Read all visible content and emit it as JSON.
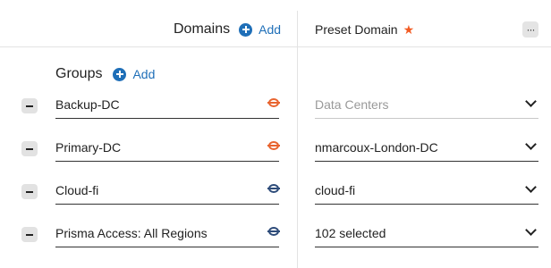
{
  "header": {
    "domains_title": "Domains",
    "add_label": "Add",
    "preset_title": "Preset Domain",
    "star_glyph": "★",
    "more_glyph": "···"
  },
  "groups": {
    "title": "Groups",
    "add_label": "Add"
  },
  "rows": [
    {
      "name": "Backup-DC",
      "status_color": "orange",
      "selection": "Data Centers",
      "is_placeholder": true
    },
    {
      "name": "Primary-DC",
      "status_color": "orange",
      "selection": "nmarcoux-London-DC",
      "is_placeholder": false
    },
    {
      "name": "Cloud-fi",
      "status_color": "blue",
      "selection": "cloud-fi",
      "is_placeholder": false
    },
    {
      "name": "Prisma Access: All Regions",
      "status_color": "blue",
      "selection": "102 selected",
      "is_placeholder": false
    }
  ],
  "colors": {
    "accent": "#1f6fb8",
    "star": "#f25c24",
    "status_orange": "#e8642f",
    "status_blue": "#2e4c7a"
  },
  "icons": {
    "add": "plus-circle-icon",
    "remove": "minus-icon",
    "status": "domain-status-icon",
    "dropdown": "chevron-down-icon",
    "more": "more-options-icon",
    "star": "star-icon"
  }
}
